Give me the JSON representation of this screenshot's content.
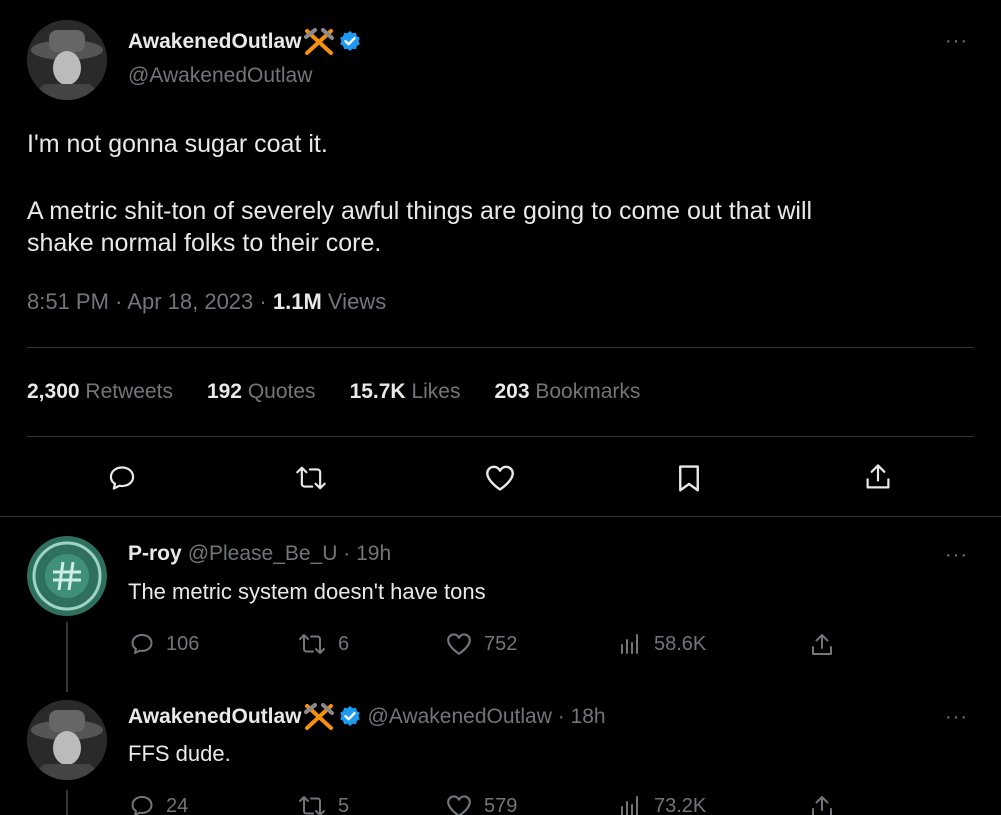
{
  "main_tweet": {
    "display_name": "AwakenedOutlaw",
    "handle": "@AwakenedOutlaw",
    "text_line1": "I'm not gonna sugar coat it.",
    "text_line2": "A metric shit-ton of severely awful things are going to come out that will",
    "text_line3": "shake normal folks to their core.",
    "time": "8:51 PM",
    "date": "Apr 18, 2023",
    "views_count": "1.1M",
    "views_label": "Views",
    "more": "···",
    "stats": [
      {
        "num": "2,300",
        "label": "Retweets"
      },
      {
        "num": "192",
        "label": "Quotes"
      },
      {
        "num": "15.7K",
        "label": "Likes"
      },
      {
        "num": "203",
        "label": "Bookmarks"
      }
    ]
  },
  "replies": [
    {
      "display_name": "P-roy",
      "handle": "@Please_Be_U",
      "time": "19h",
      "text": "The metric system doesn't have tons",
      "replies": "106",
      "retweets": "6",
      "likes": "752",
      "views": "58.6K",
      "more": "···"
    },
    {
      "display_name": "AwakenedOutlaw",
      "handle": "@AwakenedOutlaw",
      "time": "18h",
      "text": "FFS dude.",
      "replies": "24",
      "retweets": "5",
      "likes": "579",
      "views": "73.2K",
      "more": "···"
    }
  ],
  "icons": {
    "verified": "verified-badge-icon",
    "emoji": "hammer-and-pick-icon",
    "reply": "reply-icon",
    "retweet": "retweet-icon",
    "like": "heart-icon",
    "bookmark": "bookmark-icon",
    "share": "share-icon",
    "views": "views-icon"
  },
  "colors": {
    "background": "#000000",
    "text": "#e7e9ea",
    "muted": "#71767b",
    "verified": "#1d9bf0",
    "emoji": "#f4900c",
    "divider": "#2f3336"
  }
}
